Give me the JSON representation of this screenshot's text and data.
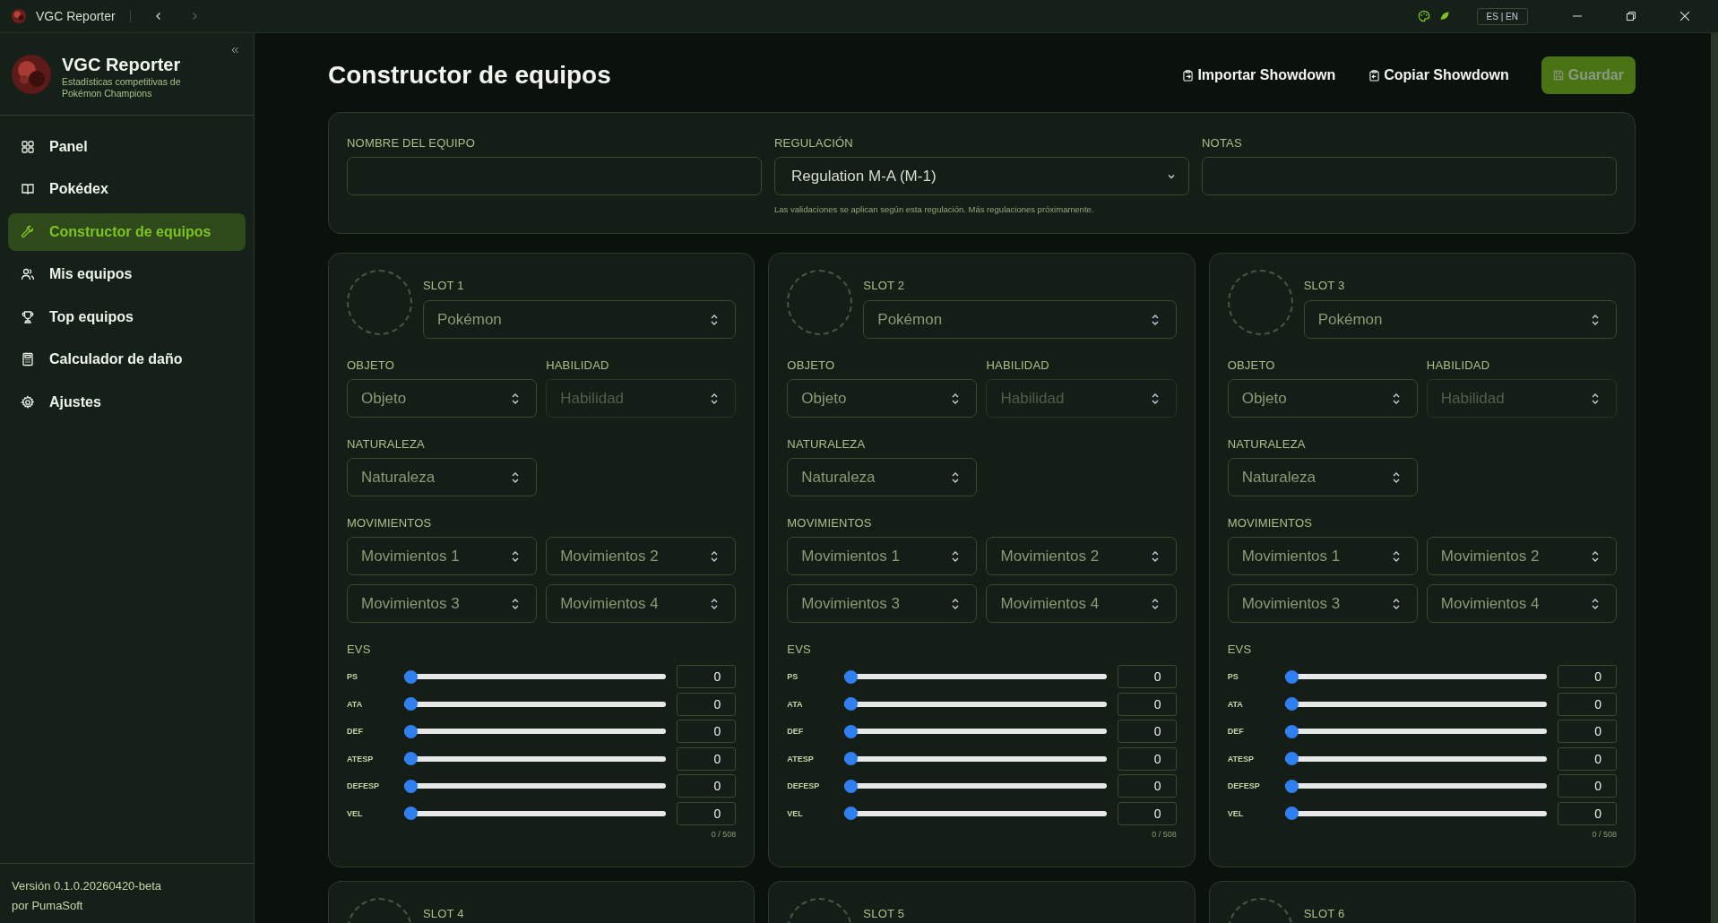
{
  "titlebar": {
    "app_name": "VGC Reporter",
    "back_disabled": false,
    "forward_disabled": true,
    "language": "ES | EN"
  },
  "sidebar": {
    "title": "VGC Reporter",
    "subtitle": "Estadísticas competitivas de Pokémon Champions",
    "items": [
      {
        "label": "Panel",
        "selected": false
      },
      {
        "label": "Pokédex",
        "selected": false
      },
      {
        "label": "Constructor de equipos",
        "selected": true
      },
      {
        "label": "Mis equipos",
        "selected": false
      },
      {
        "label": "Top equipos",
        "selected": false
      },
      {
        "label": "Calculador de daño",
        "selected": false
      },
      {
        "label": "Ajustes",
        "selected": false
      }
    ],
    "version": "Versión 0.1.0.20260420-beta",
    "author": "por PumaSoft"
  },
  "page": {
    "title": "Constructor de equipos",
    "actions": [
      {
        "kind": "import",
        "label": "Importar Showdown",
        "disabled": false
      },
      {
        "kind": "copy",
        "label": "Copiar Showdown",
        "disabled": false
      },
      {
        "kind": "save",
        "label": "Guardar",
        "disabled": true
      }
    ]
  },
  "team_form": {
    "fields": [
      {
        "kind": "text",
        "label": "NOMBRE DEL EQUIPO"
      },
      {
        "kind": "select",
        "label": "REGULACIÓN",
        "value": "Regulation M-A (M-1)",
        "hint": "Las validaciones se aplican según esta regulación. Más regulaciones próximamente."
      },
      {
        "kind": "text",
        "label": "NOTAS"
      }
    ]
  },
  "slots": [
    {
      "label": "SLOT 1",
      "pokemon": "Pokémon",
      "item_label": "OBJETO",
      "item": "Objeto",
      "ability_label": "HABILIDAD",
      "ability": "Habilidad",
      "ability_disabled": true,
      "nature_label": "NATURALEZA",
      "nature": "Naturaleza",
      "moves_label": "MOVIMIENTOS",
      "moves": [
        "Movimientos 1",
        "Movimientos 2",
        "Movimientos 3",
        "Movimientos 4"
      ],
      "evs_label": "EVS",
      "evs": [
        {
          "stat": "PS",
          "level": 0,
          "value": "0"
        },
        {
          "stat": "ATA",
          "level": 0,
          "value": "0"
        },
        {
          "stat": "DEF",
          "level": 0,
          "value": "0"
        },
        {
          "stat": "ATESP",
          "level": 0,
          "value": "0"
        },
        {
          "stat": "DEFESP",
          "level": 0,
          "value": "0"
        },
        {
          "stat": "VEL",
          "level": 0,
          "value": "0"
        }
      ],
      "ev_total": "0 / 508"
    },
    {
      "label": "SLOT 2",
      "pokemon": "Pokémon",
      "item_label": "OBJETO",
      "item": "Objeto",
      "ability_label": "HABILIDAD",
      "ability": "Habilidad",
      "ability_disabled": true,
      "nature_label": "NATURALEZA",
      "nature": "Naturaleza",
      "moves_label": "MOVIMIENTOS",
      "moves": [
        "Movimientos 1",
        "Movimientos 2",
        "Movimientos 3",
        "Movimientos 4"
      ],
      "evs_label": "EVS",
      "evs": [
        {
          "stat": "PS",
          "level": 0,
          "value": "0"
        },
        {
          "stat": "ATA",
          "level": 0,
          "value": "0"
        },
        {
          "stat": "DEF",
          "level": 0,
          "value": "0"
        },
        {
          "stat": "ATESP",
          "level": 0,
          "value": "0"
        },
        {
          "stat": "DEFESP",
          "level": 0,
          "value": "0"
        },
        {
          "stat": "VEL",
          "level": 0,
          "value": "0"
        }
      ],
      "ev_total": "0 / 508"
    },
    {
      "label": "SLOT 3",
      "pokemon": "Pokémon",
      "item_label": "OBJETO",
      "item": "Objeto",
      "ability_label": "HABILIDAD",
      "ability": "Habilidad",
      "ability_disabled": true,
      "nature_label": "NATURALEZA",
      "nature": "Naturaleza",
      "moves_label": "MOVIMIENTOS",
      "moves": [
        "Movimientos 1",
        "Movimientos 2",
        "Movimientos 3",
        "Movimientos 4"
      ],
      "evs_label": "EVS",
      "evs": [
        {
          "stat": "PS",
          "level": 0,
          "value": "0"
        },
        {
          "stat": "ATA",
          "level": 0,
          "value": "0"
        },
        {
          "stat": "DEF",
          "level": 0,
          "value": "0"
        },
        {
          "stat": "ATESP",
          "level": 0,
          "value": "0"
        },
        {
          "stat": "DEFESP",
          "level": 0,
          "value": "0"
        },
        {
          "stat": "VEL",
          "level": 0,
          "value": "0"
        }
      ],
      "ev_total": "0 / 508"
    },
    {
      "label": "SLOT 4"
    },
    {
      "label": "SLOT 5"
    },
    {
      "label": "SLOT 6"
    }
  ]
}
